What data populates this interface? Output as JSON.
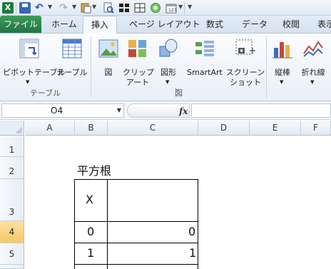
{
  "quick_access": {
    "icons": [
      "excel-icon",
      "save-icon",
      "undo-icon",
      "redo-icon",
      "paste-icon",
      "print-preview-icon",
      "borders-icon",
      "merge-icon",
      "chart-icon",
      "calendar-icon",
      "customize-icon"
    ]
  },
  "tabs": [
    {
      "label": "ファイル",
      "active": false
    },
    {
      "label": "ホーム",
      "active": false
    },
    {
      "label": "挿入",
      "active": true
    },
    {
      "label": "ページ レイアウト",
      "active": false
    },
    {
      "label": "数式",
      "active": false
    },
    {
      "label": "データ",
      "active": false
    },
    {
      "label": "校閲",
      "active": false
    },
    {
      "label": "表示",
      "active": false
    }
  ],
  "ribbon": {
    "groups": {
      "table": {
        "label": "テーブル",
        "buttons": [
          {
            "label": "ピボットテーブル",
            "icon": "pivot-table-icon"
          },
          {
            "label": "テーブル",
            "icon": "table-icon"
          }
        ]
      },
      "illustrations": {
        "label": "図",
        "buttons": [
          {
            "label": "図",
            "icon": "picture-icon"
          },
          {
            "label_line1": "クリップ",
            "label_line2": "アート",
            "icon": "clip-art-icon"
          },
          {
            "label": "図形",
            "icon": "shapes-icon"
          },
          {
            "label": "SmartArt",
            "icon": "smartart-icon"
          },
          {
            "label_line1": "スクリーン",
            "label_line2": "ショット",
            "icon": "screenshot-icon"
          }
        ]
      },
      "charts": {
        "buttons": [
          {
            "label": "縦棒",
            "icon": "column-chart-icon"
          },
          {
            "label": "折れ線",
            "icon": "line-chart-icon"
          }
        ]
      }
    }
  },
  "formula_bar": {
    "name_box": "O4",
    "fx_label": "fx",
    "formula": ""
  },
  "sheet": {
    "columns": [
      "A",
      "B",
      "C",
      "D",
      "E",
      "F"
    ],
    "rows": [
      "1",
      "2",
      "3",
      "4",
      "5"
    ],
    "active_row": "4",
    "cells": {
      "B2": "平方根",
      "B3": "X",
      "B4": "0",
      "C4": "0",
      "B5": "1",
      "C5": "1"
    }
  },
  "colors": {
    "file_tab": "#217346",
    "active_row_header": "#f5c867",
    "ribbon_bg": "#e9eff8"
  }
}
